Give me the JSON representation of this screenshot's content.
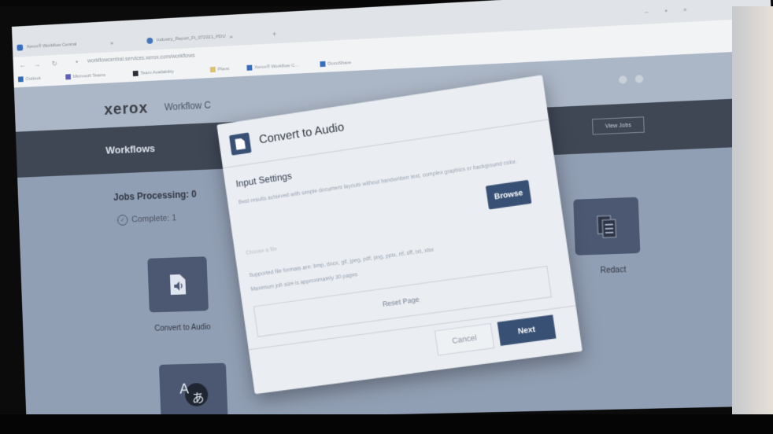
{
  "browser": {
    "tabs": [
      {
        "label": "Xerox® Workflow Central"
      },
      {
        "label": "Industry_Report_Ft_072021_PDU"
      }
    ],
    "new_tab_label": "+",
    "url": "workflowcentral.services.xerox.com/workflows",
    "bookmarks": [
      "Outlook",
      "Microsoft Teams",
      "Team Availability",
      "Plans",
      "Xerox® Workflow C...",
      "DocuShare"
    ]
  },
  "app": {
    "logo": "xerox",
    "title": "Workflow C",
    "workflows_label": "Workflows",
    "view_jobs_label": "View Jobs",
    "jobs_processing": "Jobs Processing: 0",
    "complete": "Complete: 1",
    "tiles": [
      {
        "label": "Convert to Audio",
        "icon": "audio-document-icon"
      },
      {
        "label": "",
        "icon": "translate-icon"
      },
      {
        "label": "Redact",
        "icon": "redact-icon"
      }
    ]
  },
  "modal": {
    "title": "Convert to Audio",
    "section_title": "Input Settings",
    "description": "Best results achieved with simple document layouts without handwritten text, complex graphics or background color.",
    "browse_label": "Browse",
    "file_placeholder": "Choose a file",
    "formats_note": "Supported file formats are: bmp, docx, gif, jpeg, pdf, png, pptx, rtf, tiff, txt, xlsx",
    "size_note": "Maximum job size is approximately 30 pages",
    "reset_label": "Reset Page",
    "cancel_label": "Cancel",
    "next_label": "Next"
  },
  "colors": {
    "accent": "#33507a",
    "header_bar": "#3e4758",
    "background": "#8f9fb8"
  }
}
